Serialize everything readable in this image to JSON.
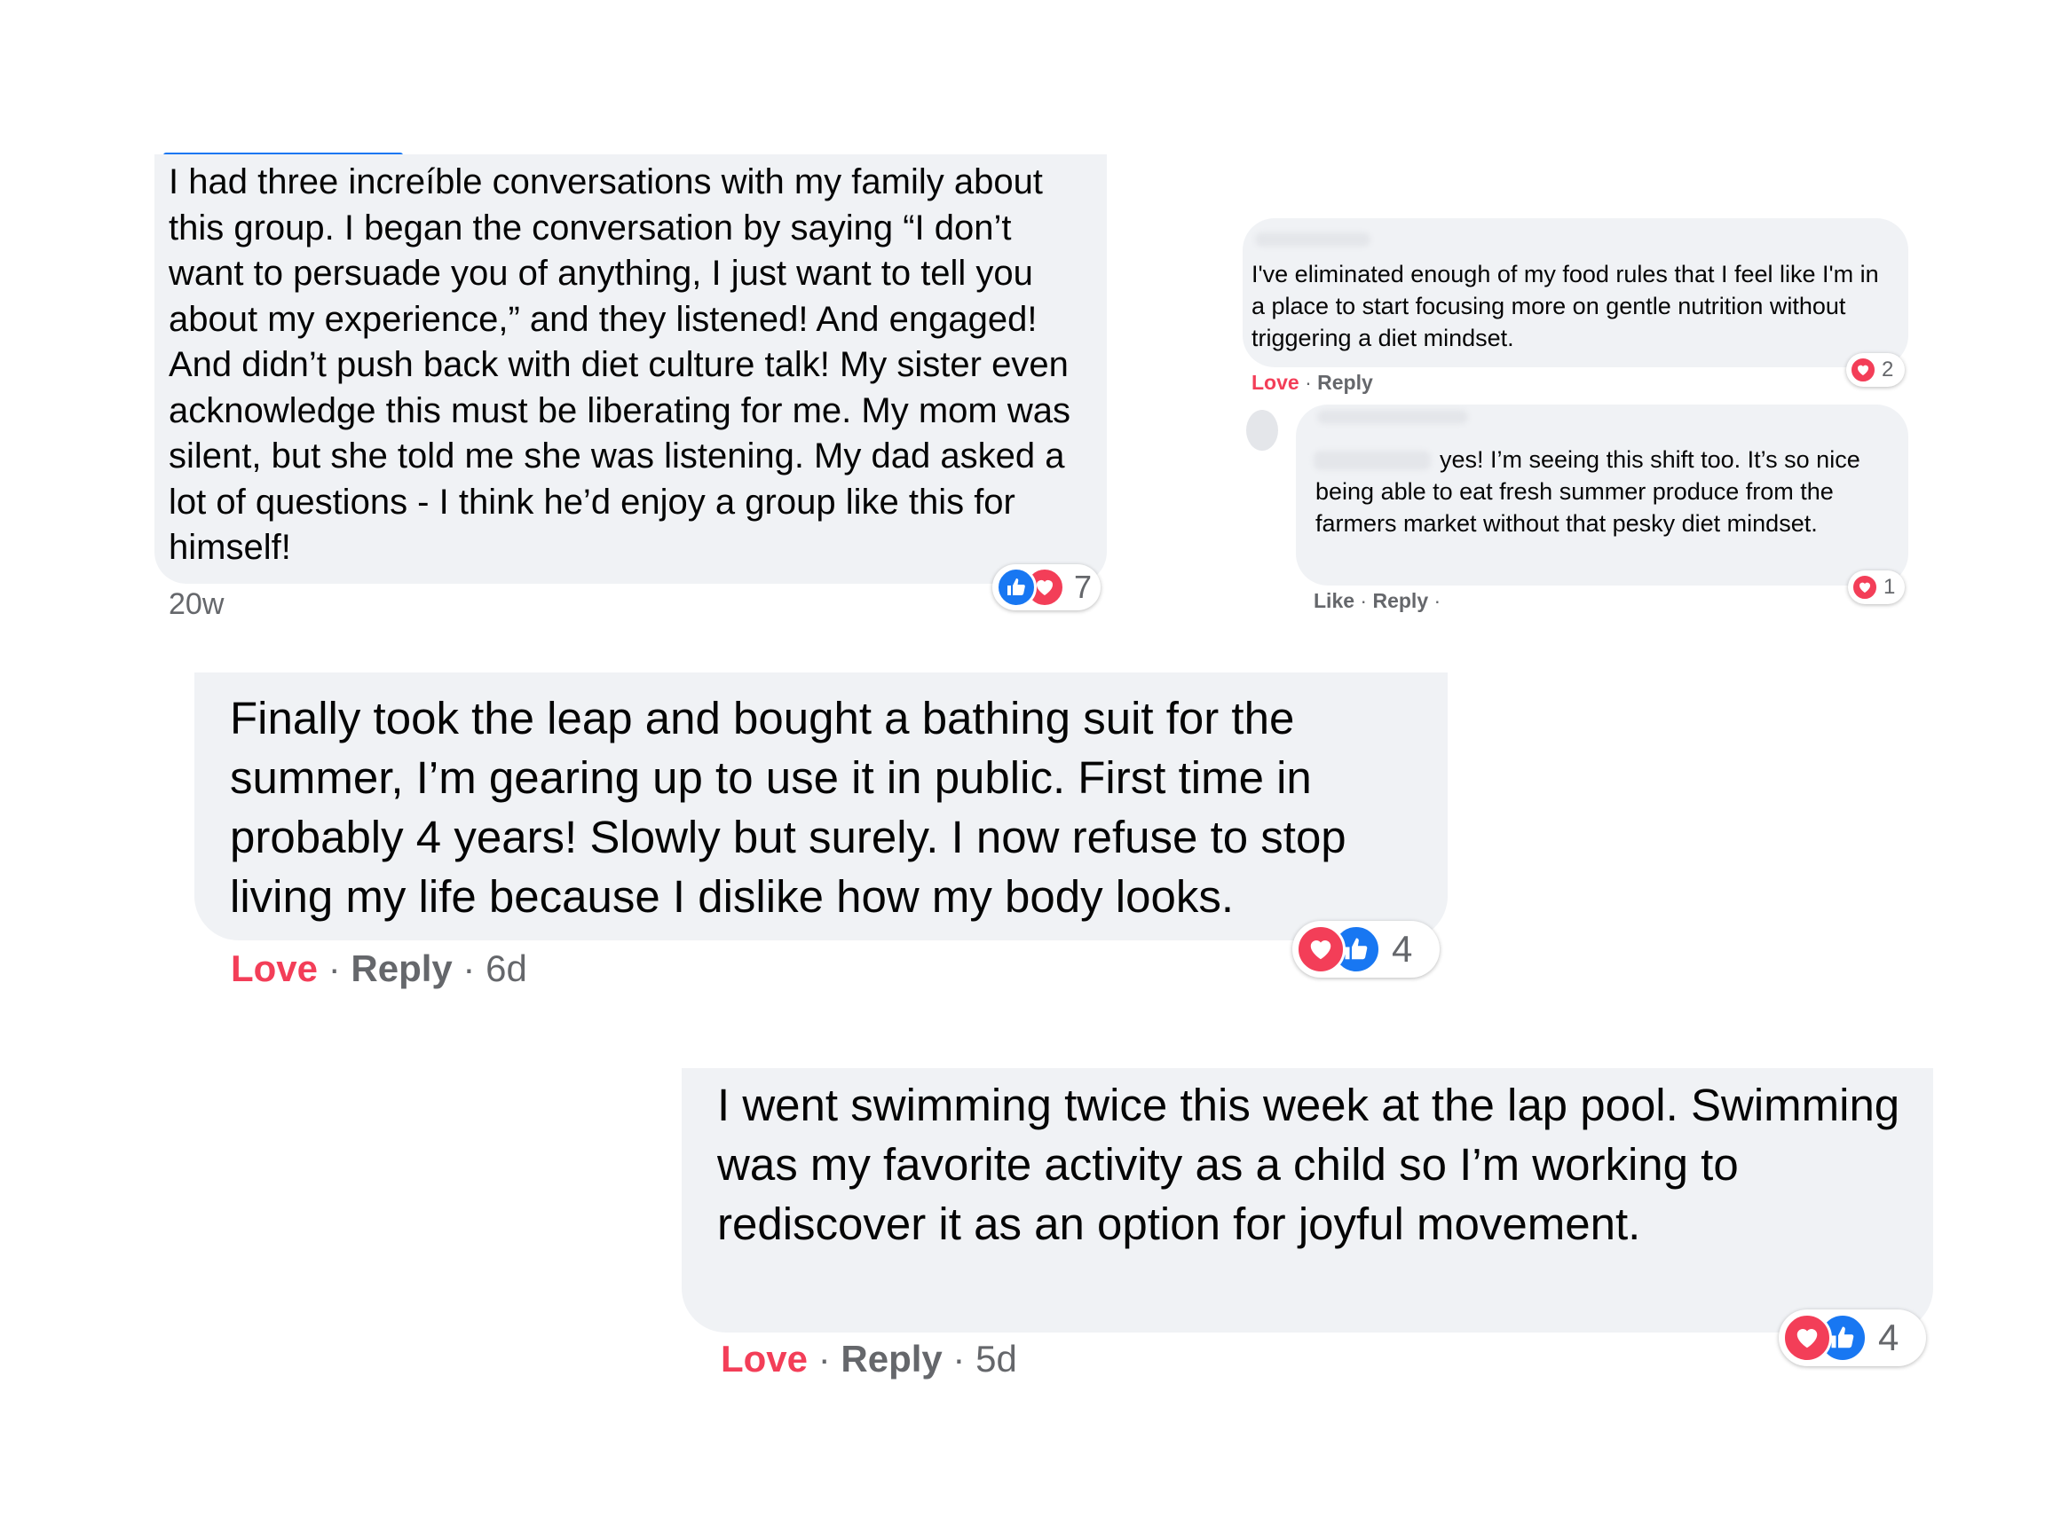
{
  "comments": [
    {
      "text": "I had three increíble conversations with my family about this group. I began the conversation by saying “I don’t want to persuade you of anything, I just want to tell you about my experience,” and they listened! And engaged! And didn’t push back with diet culture talk! My sister even acknowledge this must be liberating for me. My mom was silent, but she told me she was listening. My dad asked a lot of questions - I think he’d enjoy a group like this for himself!",
      "time": "20w",
      "reactions": {
        "icons": [
          "like-icon",
          "love-icon"
        ],
        "count": "7"
      }
    },
    {
      "text": "I've eliminated enough of my food rules that I feel like I'm in a place to start focusing more on gentle nutrition without triggering a diet mindset.",
      "love_label": "Love",
      "reply_label": "Reply",
      "reactions": {
        "icons": [
          "love-icon"
        ],
        "count": "2"
      }
    },
    {
      "text": "yes! I’m seeing this shift too. It’s so nice being able to eat fresh summer produce from the farmers market without that pesky diet mindset.",
      "like_label": "Like",
      "reply_label": "Reply",
      "reactions": {
        "icons": [
          "love-icon"
        ],
        "count": "1"
      }
    },
    {
      "text": "Finally took the leap and bought a bathing suit for the summer, I’m gearing up to use it in public. First time in probably 4 years! Slowly but surely. I now refuse to stop living my life because I dislike how my body looks.",
      "love_label": "Love",
      "reply_label": "Reply",
      "time": "6d",
      "reactions": {
        "icons": [
          "love-icon",
          "like-icon"
        ],
        "count": "4"
      }
    },
    {
      "text": "I went swimming twice this week at the lap pool. Swimming was my favorite activity as a child so I’m working to rediscover it as an option for joyful movement.",
      "love_label": "Love",
      "reply_label": "Reply",
      "time": "5d",
      "reactions": {
        "icons": [
          "love-icon",
          "like-icon"
        ],
        "count": "4"
      }
    }
  ],
  "separator": "·",
  "colors": {
    "love": "#f33e58",
    "like": "#1877f2",
    "bubble": "#f0f2f5",
    "meta": "#65676b"
  }
}
